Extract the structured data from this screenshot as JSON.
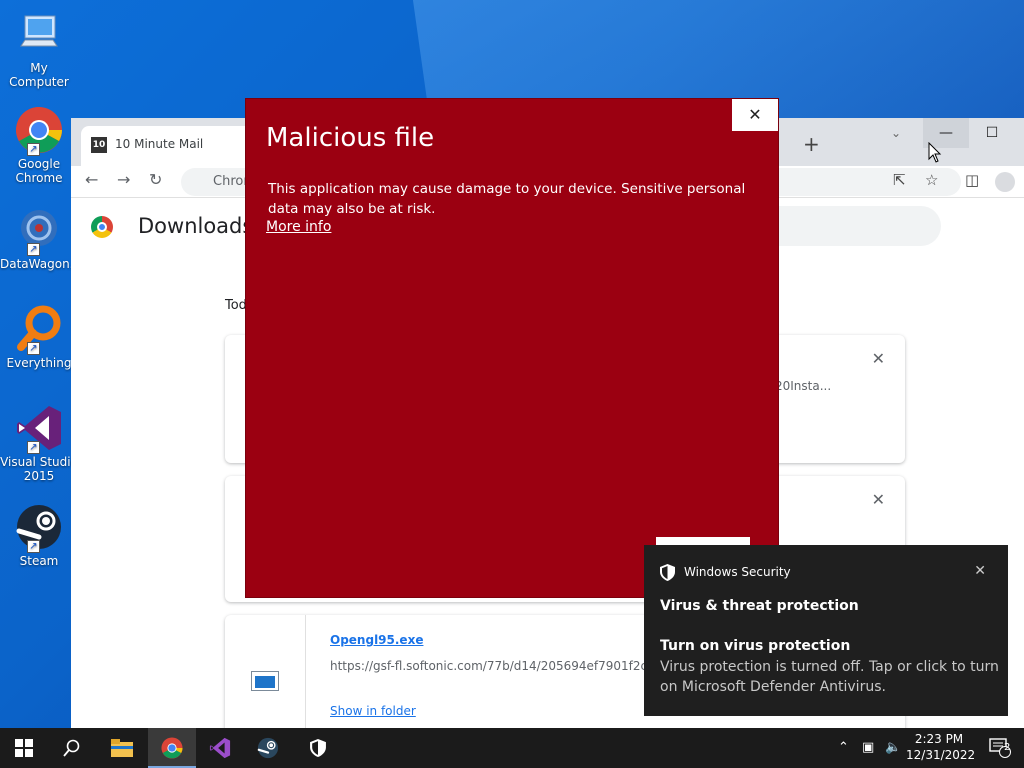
{
  "desktop": {
    "icons": [
      {
        "label": "My Computer"
      },
      {
        "label": "Google Chrome"
      },
      {
        "label": "DataWagon..."
      },
      {
        "label": "Everything"
      },
      {
        "label": "Visual Studio 2015"
      },
      {
        "label": "Steam"
      }
    ]
  },
  "browser": {
    "tab_title": "10 Minute Mail",
    "tab_favicon_text": "10",
    "new_tab": "+",
    "omnibox_text": "Chrome",
    "page_title": "Downloads",
    "today_label": "Today",
    "card1_partial": "20Insta...",
    "file_name": "Opengl95.exe",
    "file_url": "https://gsf-fl.softonic.com/77b/d14/205694ef7901f2c",
    "show_in_folder": "Show in folder"
  },
  "dialog": {
    "title": "Malicious file",
    "message": "This application may cause damage to your device. Sensitive personal data may also be at risk.",
    "more_info": "More info",
    "accent": "#9b0011"
  },
  "toast": {
    "app_name": "Windows Security",
    "heading": "Virus & threat protection",
    "subheading": "Turn on virus protection",
    "body": "Virus protection is turned off. Tap or click to turn on Microsoft Defender Antivirus."
  },
  "taskbar": {
    "time": "2:23 PM",
    "date": "12/31/2022",
    "notification_count": "2"
  }
}
